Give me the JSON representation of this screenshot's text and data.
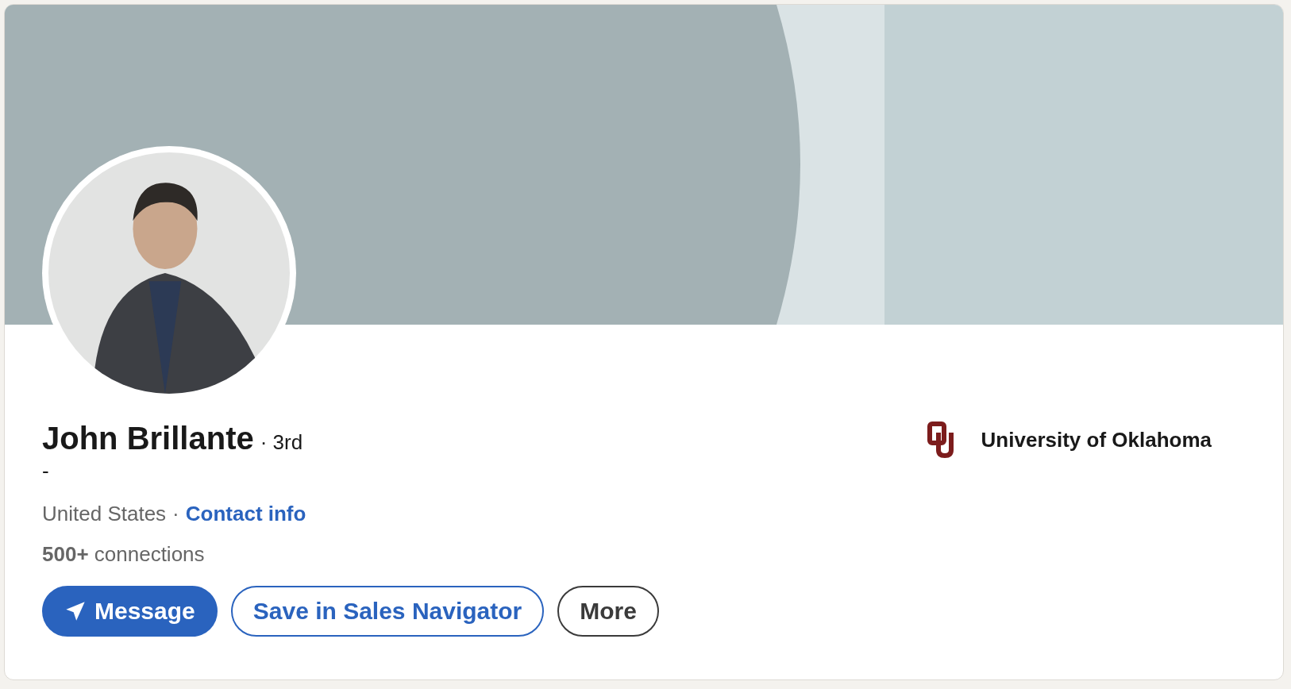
{
  "profile": {
    "name": "John Brillante",
    "degree": "· 3rd",
    "headline": "-",
    "location": "United States",
    "separator": "·",
    "contact_link": "Contact info",
    "connections": "**500+** connections"
  },
  "education": {
    "school": "University of Oklahoma"
  },
  "actions": [
    {
      "kind": "primary",
      "label": "Message"
    },
    {
      "kind": "secondary",
      "label": "Save in Sales Navigator"
    },
    {
      "kind": "neutral",
      "label": "More"
    }
  ]
}
